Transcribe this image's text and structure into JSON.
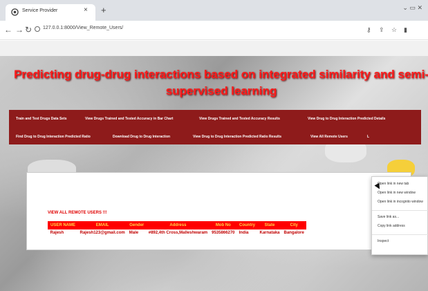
{
  "browser": {
    "tab_title": "Service Provider",
    "tab_close": "×",
    "new_tab": "+",
    "url": "127.0.0.1:8000/View_Remote_Users/",
    "window_controls": "⌄ ▭ ✕",
    "icons": [
      "back-icon",
      "forward-icon",
      "reload-icon",
      "site-info-icon",
      "key-icon",
      "share-icon",
      "star-icon",
      "sidebar-icon"
    ]
  },
  "site": {
    "title_line1": "Predicting drug-drug interactions based on integrated similarity and semi-",
    "title_line2": "supervised learning",
    "menu_row1": [
      "Train and Test Drugs Data Sets",
      "View Drugs Trained and Tested Accuracy in Bar Chart",
      "View Drugs Trained and Tested Accuracy Results",
      "View Drug to Drug Interaction Predicted Details"
    ],
    "menu_row2": [
      "Find Drug to Drug Interaction Predicted Ratio",
      "Download Drug to Drug Interaction",
      "View Drug to Drug Interaction Predicted Ratio Results",
      "View All Remote Users",
      "L"
    ]
  },
  "users": {
    "heading": "VIEW ALL REMOTE USERS !!!",
    "columns": [
      "USER NAME",
      "EMAIL",
      "Gender",
      "Address",
      "Mob No",
      "Country",
      "State",
      "City"
    ],
    "rows": [
      [
        "Rajesh",
        "Rajesh123@gmail.com",
        "Male",
        "#892,4th Cross,Malleshwaram",
        "9535866270",
        "India",
        "Karnataka",
        "Bangalore"
      ]
    ]
  },
  "context_menu": {
    "items": [
      "Open link in new tab",
      "Open link in new window",
      "Open link in incognito window",
      "Save link as...",
      "Copy link address",
      "Inspect"
    ]
  },
  "colors": {
    "menubar": "#8e1b1b",
    "title_red": "#ff1a1a",
    "table_header_bg": "#ff0000",
    "table_header_text": "#ffd84a"
  }
}
